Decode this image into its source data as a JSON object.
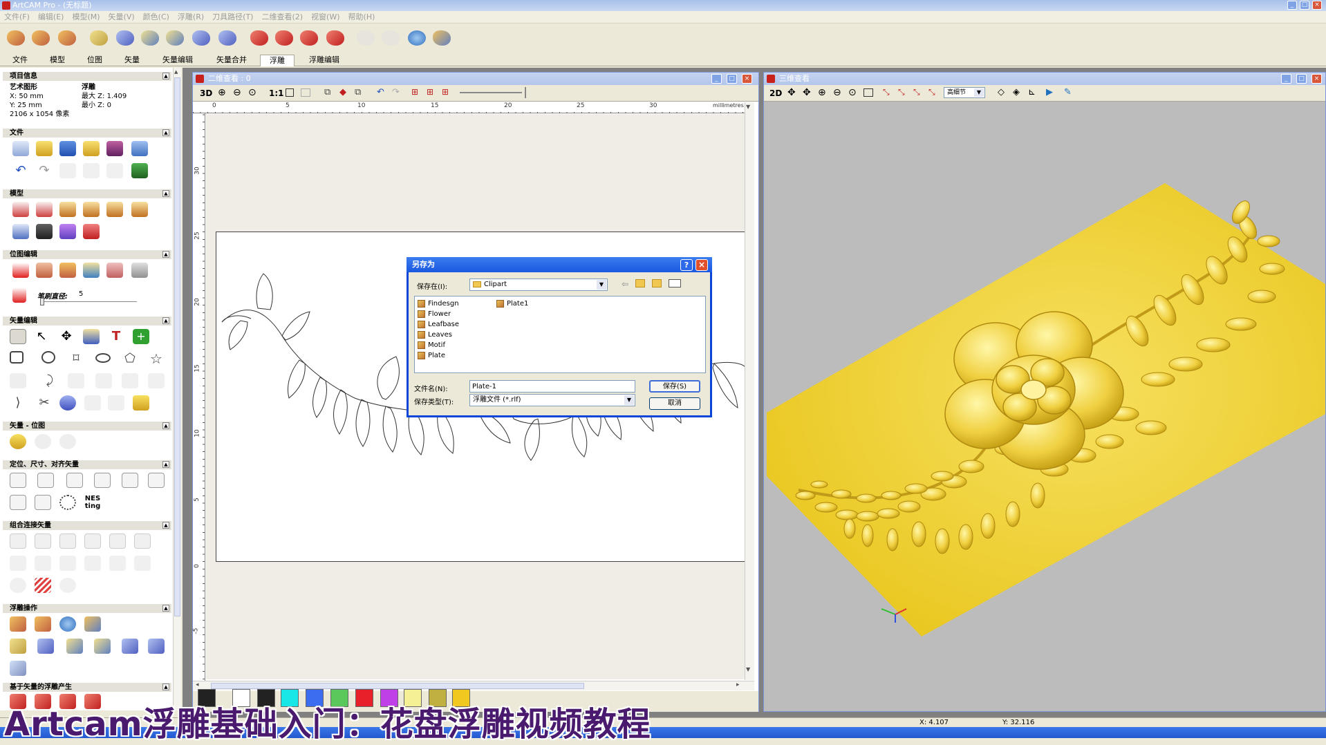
{
  "app": {
    "title": "ArtCAM Pro - (无标题)"
  },
  "menu": [
    "文件(F)",
    "编辑(E)",
    "模型(M)",
    "矢量(V)",
    "颜色(C)",
    "浮雕(R)",
    "刀具路径(T)",
    "二维查看(2)",
    "视窗(W)",
    "帮助(H)"
  ],
  "tabs": [
    "文件",
    "模型",
    "位图",
    "矢量",
    "矢量编辑",
    "矢量合并",
    "浮雕",
    "浮雕编辑"
  ],
  "project_info": {
    "header": "项目信息",
    "col1_label": "艺术图形",
    "col2_label": "浮雕",
    "x": "X: 50 mm",
    "y": "Y: 25 mm",
    "max_z": "最大 Z: 1.409",
    "min_z": "最小 Z: 0",
    "pixels": "2106 x 1054 像素"
  },
  "sections": {
    "file": "文件",
    "model": "模型",
    "bitmap_edit": "位图编辑",
    "brush_label": "笔刷直径:",
    "brush_value": "5",
    "vector_edit": "矢量编辑",
    "vector_bitmap": "矢量 - 位图",
    "align": "定位、尺寸、对齐矢量",
    "combine": "组合连接矢量",
    "relief_ops": "浮雕操作",
    "vector_relief": "基于矢量的浮雕产生",
    "nesting": "NES ting"
  },
  "view2d": {
    "title": "二维查看 : 0",
    "zoom_3d": "3D",
    "one_to_one": "1:1",
    "units": "millimetres",
    "h_ticks": [
      "0",
      "5",
      "10",
      "15",
      "20",
      "25",
      "30"
    ],
    "v_ticks": [
      "30",
      "25",
      "20",
      "15",
      "10",
      "5",
      "0",
      "-5"
    ]
  },
  "view3d": {
    "title": "三维查看",
    "mode_2d": "2D",
    "detail_select": "高细节"
  },
  "dialog": {
    "title": "另存为",
    "save_in_label": "保存在(I):",
    "save_in_value": "Clipart",
    "files_col1": [
      "Findesgn",
      "Flower",
      "Leafbase",
      "Leaves",
      "Motif",
      "Plate"
    ],
    "files_col2": [
      "Plate1"
    ],
    "filename_label": "文件名(N):",
    "filename_value": "Plate-1",
    "filetype_label": "保存类型(T):",
    "filetype_value": "浮雕文件 (*.rlf)",
    "save_button": "保存(S)",
    "cancel_button": "取消"
  },
  "status": {
    "x": "X: 4.107",
    "y": "Y: 32.116"
  },
  "caption": "Artcam浮雕基础入门：花盘浮雕视频教程",
  "colors": {
    "accent": "#0845d8",
    "relief": "#f2d21e",
    "swatches": [
      "#ffffff",
      "#222222",
      "#19e6e6",
      "#3c6cf0",
      "#5ac85a",
      "#e8202a",
      "#c040e8",
      "#f5f096",
      "#c0b040",
      "#f0c820"
    ]
  }
}
